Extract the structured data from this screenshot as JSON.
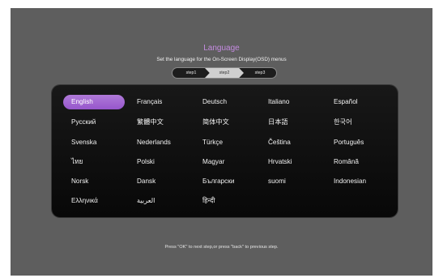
{
  "header": {
    "title": "Language",
    "subtitle": "Set the language for the On-Screen Display(OSD) menus"
  },
  "steps": [
    {
      "label": "step1"
    },
    {
      "label": "step2"
    },
    {
      "label": "step3"
    }
  ],
  "current_step": "step2",
  "languages": [
    {
      "label": "English",
      "selected": true
    },
    {
      "label": "Français"
    },
    {
      "label": "Deutsch"
    },
    {
      "label": "Italiano"
    },
    {
      "label": "Español"
    },
    {
      "label": "Русский"
    },
    {
      "label": "繁體中文"
    },
    {
      "label": "简体中文"
    },
    {
      "label": "日本語"
    },
    {
      "label": "한국어"
    },
    {
      "label": "Svenska"
    },
    {
      "label": "Nederlands"
    },
    {
      "label": "Türkçe"
    },
    {
      "label": "Čeština"
    },
    {
      "label": "Português"
    },
    {
      "label": "ไทย"
    },
    {
      "label": "Polski"
    },
    {
      "label": "Magyar"
    },
    {
      "label": "Hrvatski"
    },
    {
      "label": "Română"
    },
    {
      "label": "Norsk"
    },
    {
      "label": "Dansk"
    },
    {
      "label": "Български"
    },
    {
      "label": "suomi"
    },
    {
      "label": "Indonesian"
    },
    {
      "label": "Ελληνικά"
    },
    {
      "label": "العربية"
    },
    {
      "label": "हिन्दी"
    }
  ],
  "footer": {
    "hint": "Press \"OK\" to next step,or press \"back\" to previous step."
  },
  "colors": {
    "accent": "#a86ad6",
    "title": "#c48be0",
    "background": "#5e5e5e",
    "panel": "#0f0f0f"
  }
}
